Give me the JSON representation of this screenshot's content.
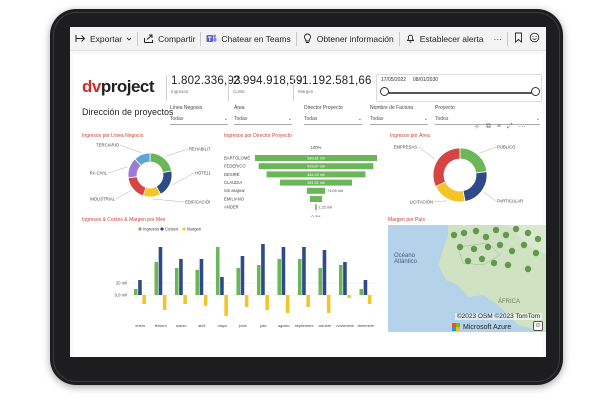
{
  "toolbar": {
    "export_label": "Exportar",
    "share_label": "Compartir",
    "teams_label": "Chatear en Teams",
    "insights_label": "Obtener información",
    "alert_label": "Establecer alerta",
    "more_label": "···"
  },
  "brand": {
    "logo_text_1": "dv",
    "logo_text_2": "project"
  },
  "page_title": "Dirección de proyectos",
  "kpis": [
    {
      "value": "1.802.336,93",
      "label": "Ingresos"
    },
    {
      "value": "2.994.918,59",
      "label": "Coste"
    },
    {
      "value": "-1.192.581,66",
      "label": "Margen"
    }
  ],
  "date_range": {
    "start": "17/05/2022",
    "end": "08/01/2030"
  },
  "filters": [
    {
      "label": "Línea Negocio",
      "value": "Todas"
    },
    {
      "label": "Área",
      "value": "Todas"
    },
    {
      "label": "Director Proyecto",
      "value": "Todas"
    },
    {
      "label": "Nombre de Factura",
      "value": "Todas"
    },
    {
      "label": "Proyecto",
      "value": "Todos"
    }
  ],
  "colors": {
    "green": "#6cb65a",
    "navy": "#2e4a8b",
    "yellow": "#f3c52b",
    "red": "#d64541",
    "purple": "#9c7bd4",
    "title_red": "#c8423c",
    "map_water": "#b4d3eb",
    "map_land": "#cfe3c3",
    "map_dot": "#4f8a3a"
  },
  "chart_titles": {
    "donut1": "Ingresos por Línea Negocio",
    "funnel": "Ingresos por Director Proyecto",
    "donut2": "Ingresos por Área",
    "bars": "Ingresos & Costes & Margen por Mes",
    "map": "Margen por País"
  },
  "chart_data": [
    {
      "type": "pie",
      "variant": "donut",
      "title": "Ingresos por Línea Negocio",
      "categories": [
        "REHABILITACIÓN",
        "HOTELERO",
        "EDIFICACIÓN",
        "INDUSTRIAL",
        "OBRA CIVIL",
        "TERCIARIO"
      ],
      "values": [
        22,
        20,
        13,
        18,
        15,
        12
      ],
      "colors": [
        "#6cb65a",
        "#2e4a8b",
        "#f3c52b",
        "#d64541",
        "#9c7bd4",
        "#59a7d8"
      ]
    },
    {
      "type": "bar",
      "variant": "funnel",
      "title": "Ingresos por Director Proyecto",
      "categories": [
        "BARTOLOMÉ",
        "FEDERICO",
        "DESIRÉ",
        "CLAUDIA",
        "Sin asignar",
        "EMILIANO",
        "ANDER"
      ],
      "values": [
        100,
        94,
        81,
        59,
        15,
        10,
        0.8
      ],
      "value_labels": [
        "589,81 mil",
        "543,97 mil",
        "484,49 mil",
        "351,51 mil",
        "71,09 mil",
        "",
        "1,22 mil"
      ],
      "top_label": "100%",
      "bottom_label": "0,2%",
      "color": "#6cb65a"
    },
    {
      "type": "pie",
      "variant": "donut",
      "title": "Ingresos por Área",
      "categories": [
        "PÚBLICO",
        "PARTICULAR",
        "LICITACIÓN",
        "EMPRESAS"
      ],
      "values": [
        23,
        24,
        21,
        32
      ],
      "colors": [
        "#6cb65a",
        "#2e4a8b",
        "#f3c52b",
        "#d64541"
      ]
    },
    {
      "type": "bar",
      "title": "Ingresos & Costes & Margen por Mes",
      "categories": [
        "enero",
        "febrero",
        "marzo",
        "abril",
        "mayo",
        "junio",
        "julio",
        "agosto",
        "septiembre",
        "octubre",
        "noviembre",
        "diciembre"
      ],
      "series": [
        {
          "name": "Ingresos",
          "values": [
            10,
            55,
            45,
            42,
            80,
            45,
            50,
            60,
            60,
            45,
            50,
            10
          ]
        },
        {
          "name": "Costes",
          "values": [
            25,
            80,
            60,
            60,
            30,
            65,
            85,
            80,
            80,
            75,
            55,
            25
          ]
        },
        {
          "name": "Margen",
          "values": [
            -15,
            -25,
            -15,
            -18,
            -35,
            -20,
            -25,
            -30,
            -20,
            -30,
            -5,
            -15
          ]
        }
      ],
      "yticks": [
        "20 mil",
        "0,0 mil"
      ],
      "ylim": [
        -40,
        90
      ]
    }
  ],
  "map": {
    "ocean_label_1": "Océano",
    "ocean_label_2": "Atlántico",
    "region_label": "ÁFRICA",
    "attribution": "©2023 OSM  ©2023 TomTom",
    "azure_label": "Microsoft Azure"
  }
}
